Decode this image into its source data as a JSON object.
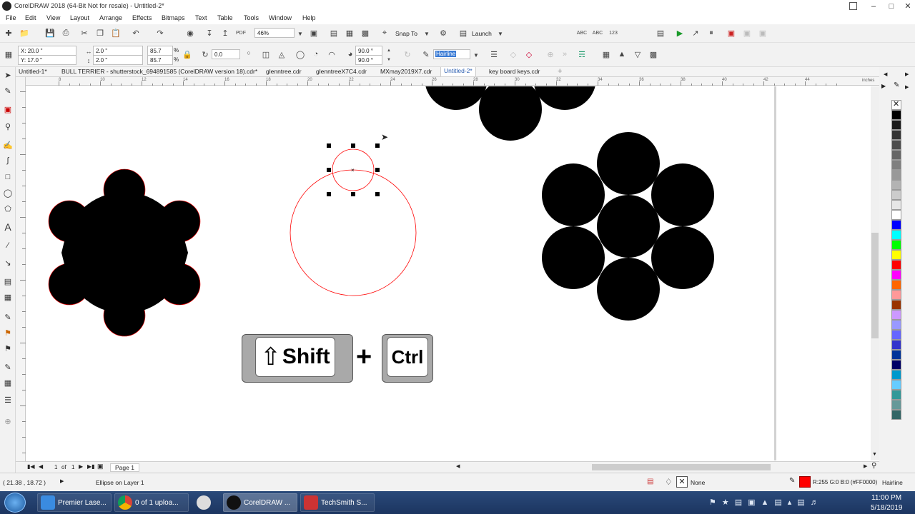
{
  "window": {
    "title": "CorelDRAW 2018 (64-Bit Not for resale) - Untitled-2*",
    "controls": [
      "minimize-icon",
      "maximize-icon",
      "close-icon"
    ]
  },
  "menu": [
    "File",
    "Edit",
    "View",
    "Layout",
    "Arrange",
    "Effects",
    "Bitmaps",
    "Text",
    "Table",
    "Tools",
    "Window",
    "Help"
  ],
  "toolbar": {
    "zoom": "46%",
    "snap_to": "Snap To",
    "launch": "Launch"
  },
  "propbar": {
    "x": "X: 20.0 \"",
    "y": "Y: 17.0 \"",
    "w": "2.0 \"",
    "h": "2.0 \"",
    "scale_w": "85.7",
    "scale_h": "85.7",
    "pct": "%",
    "rotation": "0.0",
    "angle_start": "90.0 °",
    "angle_end": "90.0 °",
    "outline": "Hairline"
  },
  "doc_tabs": [
    "Untitled-1*",
    "BULL TERRIER - shutterstock_694891585 (CorelDRAW version 18).cdr*",
    "glenntree.cdr",
    "glenntreeX7C4.cdr",
    "MXmay2019X7.cdr",
    "Untitled-2*",
    "key board keys.cdr"
  ],
  "active_tab_index": 5,
  "ruler": {
    "labels": [
      "8",
      "10",
      "12",
      "14",
      "16",
      "18",
      "20",
      "22",
      "24",
      "26",
      "28",
      "30",
      "32",
      "34",
      "36",
      "38",
      "40",
      "42",
      "44"
    ],
    "units": "inches"
  },
  "canvas": {
    "key_shift": "Shift",
    "key_plus": "+",
    "key_ctrl": "Ctrl"
  },
  "page_nav": {
    "current": "1",
    "of": "of",
    "total": "1",
    "page_tab": "Page 1"
  },
  "status": {
    "coords": "( 21.38 , 18.72 )",
    "selection": "Ellipse on Layer 1",
    "fill": "None",
    "outline_color": "R:255 G:0 B:0 (#FF0000)",
    "outline_width": "Hairline"
  },
  "taskbar": {
    "items": [
      "Premier Lase...",
      "0 of 1 uploa...",
      "",
      "CorelDRAW ...",
      "TechSmith S..."
    ],
    "time": "11:00 PM",
    "date": "5/18/2019"
  },
  "palette": [
    "#000000",
    "#1a1a1a",
    "#333333",
    "#4d4d4d",
    "#666666",
    "#808080",
    "#999999",
    "#b3b3b3",
    "#cccccc",
    "#e6e6e6",
    "#ffffff",
    "#0000ff",
    "#00ffff",
    "#00ff00",
    "#ffff00",
    "#ff0000",
    "#ff00ff",
    "#ff6600",
    "#ff9999",
    "#993300",
    "#cc99ff",
    "#9999ff",
    "#6666ff",
    "#3333cc",
    "#003399",
    "#000066",
    "#0099cc",
    "#66ccff",
    "#339999",
    "#669999",
    "#336666"
  ],
  "colors": {
    "outline": "#ff0000",
    "fill": "#000000",
    "taskbar": "#1f3a68"
  }
}
